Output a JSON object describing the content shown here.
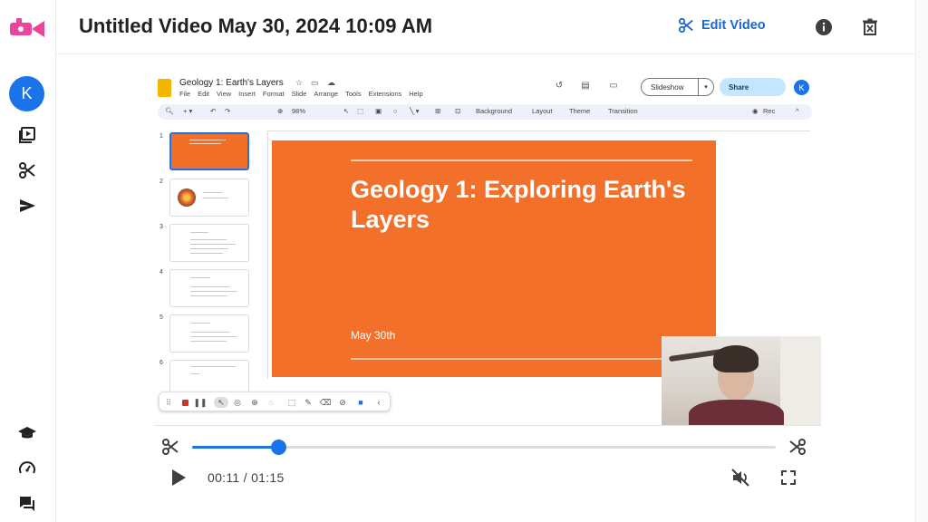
{
  "header": {
    "title": "Untitled Video May 30, 2024 10:09 AM",
    "edit_label": "Edit Video"
  },
  "rail": {
    "avatar_initial": "K",
    "icons": [
      "video-library-icon",
      "scissors-icon",
      "send-icon",
      "graduation-cap-icon",
      "gauge-icon",
      "chat-icon"
    ]
  },
  "slides_app": {
    "doc_title": "Geology 1: Earth's Layers",
    "menu": [
      "File",
      "Edit",
      "View",
      "Insert",
      "Format",
      "Slide",
      "Arrange",
      "Tools",
      "Extensions",
      "Help"
    ],
    "slideshow_label": "Slideshow",
    "share_label": "Share",
    "avatar_initial": "K",
    "zoom": "98%",
    "toolbar": {
      "background": "Background",
      "layout": "Layout",
      "theme": "Theme",
      "transition": "Transition",
      "rec": "Rec"
    },
    "thumb_numbers": [
      "1",
      "2",
      "3",
      "4",
      "5",
      "6"
    ],
    "slide": {
      "title": "Geology 1: Exploring Earth's Layers",
      "date": "May 30th"
    }
  },
  "player": {
    "current_time": "00:11",
    "total_time": "01:15",
    "time_display": "00:11 / 01:15",
    "progress_fraction": 0.147
  },
  "colors": {
    "accent": "#1a73e8",
    "slide_orange": "#f3702b",
    "logo_pink": "#e9469b"
  }
}
